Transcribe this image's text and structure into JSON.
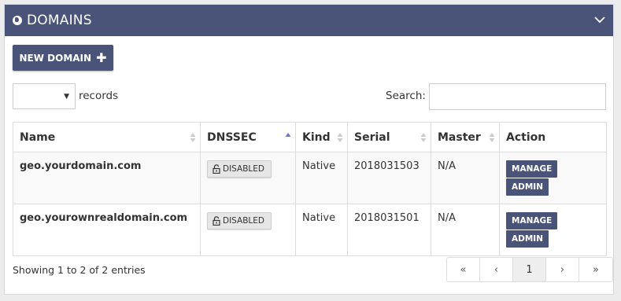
{
  "panel": {
    "title": "DOMAINS"
  },
  "toolbar": {
    "new_domain_label": "NEW DOMAIN"
  },
  "length": {
    "selected": "",
    "suffix": "records"
  },
  "search": {
    "label": "Search:",
    "value": ""
  },
  "table": {
    "columns": [
      "Name",
      "DNSSEC",
      "Kind",
      "Serial",
      "Master",
      "Action"
    ],
    "rows": [
      {
        "name": "geo.yourdomain.com",
        "dnssec": "DISABLED",
        "kind": "Native",
        "serial": "2018031503",
        "master": "N/A",
        "manage": "MANAGE",
        "admin": "ADMIN"
      },
      {
        "name": "geo.yourownrealdomain.com",
        "dnssec": "DISABLED",
        "kind": "Native",
        "serial": "2018031501",
        "master": "N/A",
        "manage": "MANAGE",
        "admin": "ADMIN"
      }
    ]
  },
  "info": "Showing 1 to 2 of 2 entries",
  "pagination": {
    "first": "«",
    "prev": "‹",
    "page": "1",
    "next": "›",
    "last": "»"
  },
  "colors": {
    "header_bg": "#4a5478",
    "button_bg": "#4a5478",
    "sort_active": "#6b76c9"
  }
}
